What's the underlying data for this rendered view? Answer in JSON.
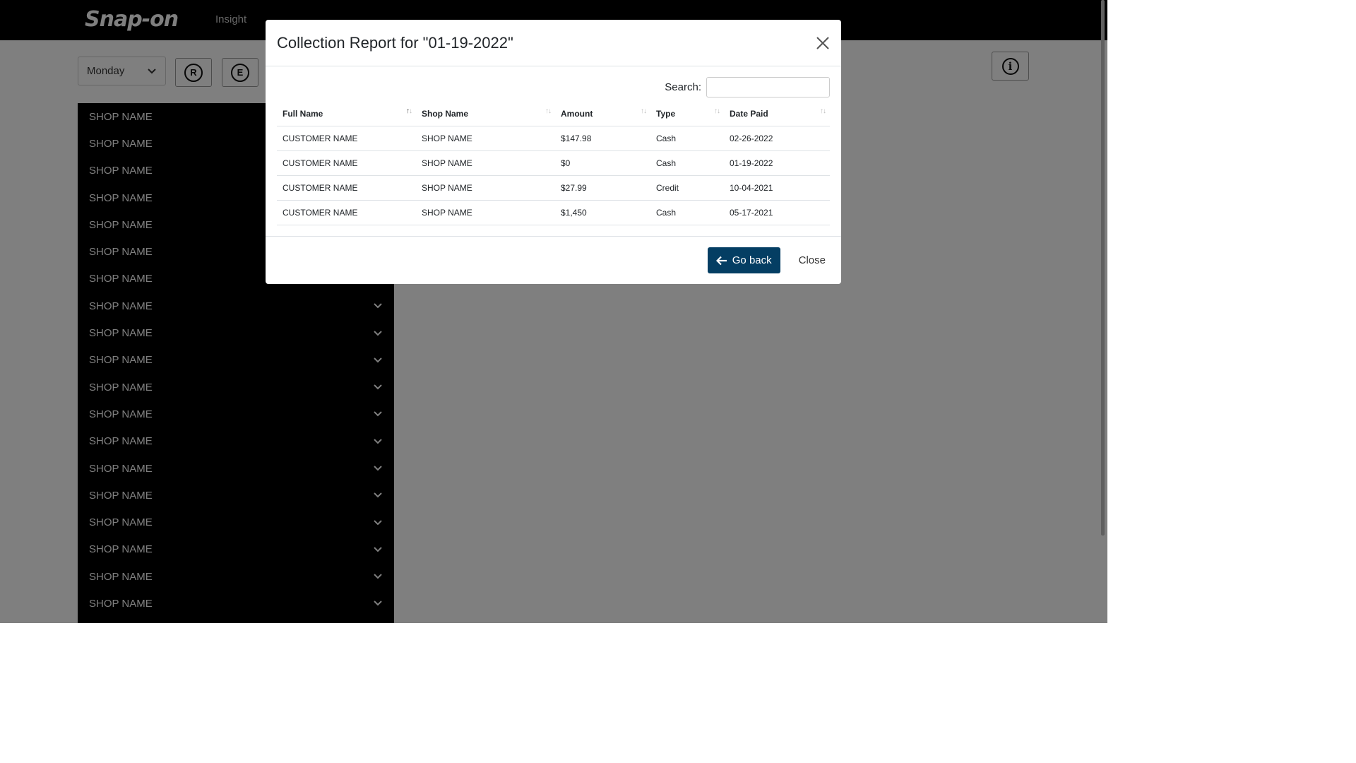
{
  "navbar": {
    "brand": "Snap-on",
    "subtitle": "Insight"
  },
  "toolbar": {
    "day_select": "Monday",
    "buttons": [
      {
        "letter": "R"
      },
      {
        "letter": "E"
      }
    ],
    "info_icon": "info-icon"
  },
  "shops": [
    "SHOP NAME",
    "SHOP NAME",
    "SHOP NAME",
    "SHOP NAME",
    "SHOP NAME",
    "SHOP NAME",
    "SHOP NAME",
    "SHOP NAME",
    "SHOP NAME",
    "SHOP NAME",
    "SHOP NAME",
    "SHOP NAME",
    "SHOP NAME",
    "SHOP NAME",
    "SHOP NAME",
    "SHOP NAME",
    "SHOP NAME",
    "SHOP NAME",
    "SHOP NAME"
  ],
  "modal": {
    "title": "Collection Report for \"01-19-2022\"",
    "search_label": "Search:",
    "search_value": "",
    "columns": [
      "Full Name",
      "Shop Name",
      "Amount",
      "Type",
      "Date Paid"
    ],
    "rows": [
      [
        "CUSTOMER NAME",
        "SHOP NAME",
        "$147.98",
        "Cash",
        "02-26-2022"
      ],
      [
        "CUSTOMER NAME",
        "SHOP NAME",
        "$0",
        "Cash",
        "01-19-2022"
      ],
      [
        "CUSTOMER NAME",
        "SHOP NAME",
        "$27.99",
        "Credit",
        "10-04-2021"
      ],
      [
        "CUSTOMER NAME",
        "SHOP NAME",
        "$1,450",
        "Cash",
        "05-17-2021"
      ]
    ],
    "go_back_label": "Go back",
    "close_label": "Close"
  },
  "colors": {
    "primary": "#043e63",
    "navbar": "#000000",
    "backdrop": "rgba(0,0,0,0.5)"
  }
}
